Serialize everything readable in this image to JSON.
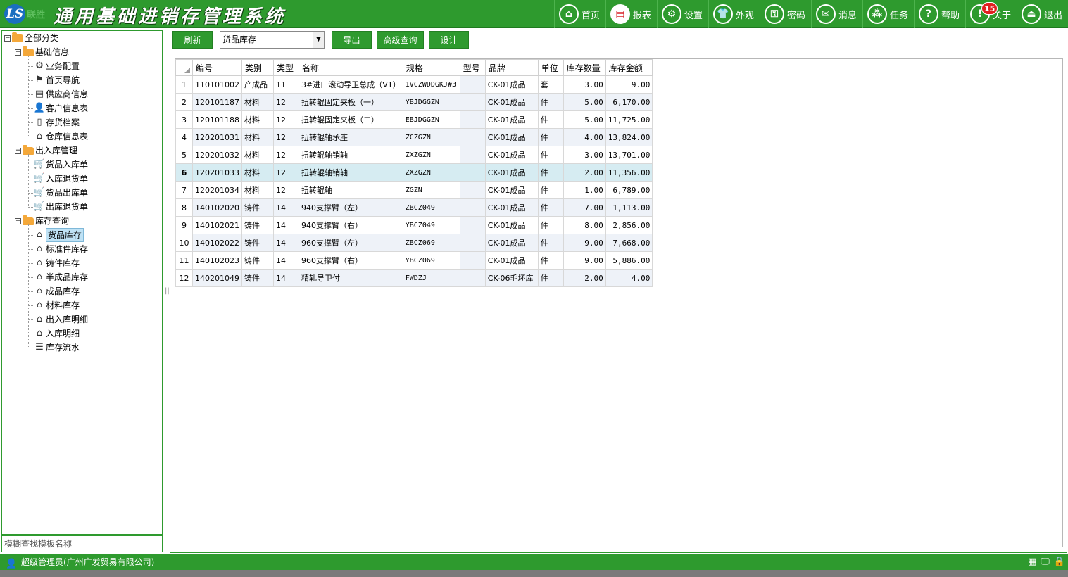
{
  "header": {
    "logo_mark": "LS",
    "logo_sub": "联胜",
    "title": "通用基础进销存管理系统",
    "nav": [
      {
        "label": "首页",
        "icon": "home-icon",
        "glyph": "⌂"
      },
      {
        "label": "报表",
        "icon": "report-icon",
        "glyph": "▤"
      },
      {
        "label": "设置",
        "icon": "gear-icon",
        "glyph": "⚙"
      },
      {
        "label": "外观",
        "icon": "shirt-icon",
        "glyph": "👕"
      },
      {
        "label": "密码",
        "icon": "key-icon",
        "glyph": "⚿"
      },
      {
        "label": "消息",
        "icon": "mail-icon",
        "glyph": "✉"
      },
      {
        "label": "任务",
        "icon": "task-icon",
        "glyph": "⁂"
      },
      {
        "label": "帮助",
        "icon": "help-icon",
        "glyph": "?"
      },
      {
        "label": "关于",
        "icon": "info-icon",
        "glyph": "!",
        "badge": "15"
      },
      {
        "label": "退出",
        "icon": "exit-icon",
        "glyph": "⏏"
      }
    ]
  },
  "tree": {
    "root": "全部分类",
    "groups": [
      {
        "label": "基础信息",
        "items": [
          {
            "label": "业务配置",
            "icon": "gear-icon",
            "glyph": "⚙"
          },
          {
            "label": "首页导航",
            "icon": "signpost-icon",
            "glyph": "⚑"
          },
          {
            "label": "供应商信息",
            "icon": "document-icon",
            "glyph": "▤"
          },
          {
            "label": "客户信息表",
            "icon": "user-icon",
            "glyph": "👤"
          },
          {
            "label": "存货档案",
            "icon": "file-icon",
            "glyph": "▯"
          },
          {
            "label": "仓库信息表",
            "icon": "warehouse-icon",
            "glyph": "⌂"
          }
        ]
      },
      {
        "label": "出入库管理",
        "items": [
          {
            "label": "货品入库单",
            "icon": "cart-icon",
            "glyph": "🛒"
          },
          {
            "label": "入库退货单",
            "icon": "cart-icon",
            "glyph": "🛒"
          },
          {
            "label": "货品出库单",
            "icon": "cart-icon",
            "glyph": "🛒"
          },
          {
            "label": "出库退货单",
            "icon": "cart-icon",
            "glyph": "🛒"
          }
        ]
      },
      {
        "label": "库存查询",
        "items": [
          {
            "label": "货品库存",
            "icon": "warehouse-icon",
            "glyph": "⌂",
            "selected": true
          },
          {
            "label": "标准件库存",
            "icon": "warehouse-icon",
            "glyph": "⌂"
          },
          {
            "label": "铸件库存",
            "icon": "warehouse-icon",
            "glyph": "⌂"
          },
          {
            "label": "半成品库存",
            "icon": "warehouse-icon",
            "glyph": "⌂"
          },
          {
            "label": "成品库存",
            "icon": "warehouse-icon",
            "glyph": "⌂"
          },
          {
            "label": "材料库存",
            "icon": "warehouse-icon",
            "glyph": "⌂"
          },
          {
            "label": "出入库明细",
            "icon": "warehouse-icon",
            "glyph": "⌂"
          },
          {
            "label": "入库明细",
            "icon": "warehouse-icon",
            "glyph": "⌂"
          },
          {
            "label": "库存流水",
            "icon": "list-icon",
            "glyph": "☰"
          }
        ]
      }
    ]
  },
  "search": {
    "placeholder": "模糊查找模板名称"
  },
  "toolbar": {
    "refresh": "刷新",
    "select_value": "货品库存",
    "export": "导出",
    "advanced": "高级查询",
    "design": "设计"
  },
  "grid": {
    "columns": [
      "编号",
      "类别",
      "类型",
      "名称",
      "规格",
      "型号",
      "品牌",
      "单位",
      "库存数量",
      "库存金额"
    ],
    "rows": [
      [
        "1",
        "110101002",
        "产成品",
        "11",
        "3#进口滚动导卫总成（V1）",
        "1VCZWDDGKJ#3",
        "",
        "CK-01成品",
        "套",
        "3.00",
        "9.00"
      ],
      [
        "2",
        "120101187",
        "材料",
        "12",
        "扭转辊固定夹板（一）",
        "YBJDGGZN",
        "",
        "CK-01成品",
        "件",
        "5.00",
        "6,170.00"
      ],
      [
        "3",
        "120101188",
        "材料",
        "12",
        "扭转辊固定夹板（二）",
        "EBJDGGZN",
        "",
        "CK-01成品",
        "件",
        "5.00",
        "11,725.00"
      ],
      [
        "4",
        "120201031",
        "材料",
        "12",
        "扭转辊轴承座",
        "ZCZGZN",
        "",
        "CK-01成品",
        "件",
        "4.00",
        "13,824.00"
      ],
      [
        "5",
        "120201032",
        "材料",
        "12",
        "扭转辊轴销轴",
        "ZXZGZN",
        "",
        "CK-01成品",
        "件",
        "3.00",
        "13,701.00"
      ],
      [
        "6",
        "120201033",
        "材料",
        "12",
        "扭转辊轴销轴",
        "ZXZGZN",
        "",
        "CK-01成品",
        "件",
        "2.00",
        "11,356.00"
      ],
      [
        "7",
        "120201034",
        "材料",
        "12",
        "扭转辊轴",
        "ZGZN",
        "",
        "CK-01成品",
        "件",
        "1.00",
        "6,789.00"
      ],
      [
        "8",
        "140102020",
        "铸件",
        "14",
        "940支撑臂（左）",
        "ZBCZ049",
        "",
        "CK-01成品",
        "件",
        "7.00",
        "1,113.00"
      ],
      [
        "9",
        "140102021",
        "铸件",
        "14",
        "940支撑臂（右）",
        "YBCZ049",
        "",
        "CK-01成品",
        "件",
        "8.00",
        "2,856.00"
      ],
      [
        "10",
        "140102022",
        "铸件",
        "14",
        "960支撑臂（左）",
        "ZBCZ069",
        "",
        "CK-01成品",
        "件",
        "9.00",
        "7,668.00"
      ],
      [
        "11",
        "140102023",
        "铸件",
        "14",
        "960支撑臂（右）",
        "YBCZ069",
        "",
        "CK-01成品",
        "件",
        "9.00",
        "5,886.00"
      ],
      [
        "12",
        "140201049",
        "铸件",
        "14",
        "精轧导卫付",
        "FWDZJ",
        "",
        "CK-06毛坯库",
        "件",
        "2.00",
        "4.00"
      ]
    ],
    "highlighted_row": 6
  },
  "status": {
    "user": "超级管理员(广州广发贸易有限公司)",
    "icons": [
      {
        "name": "grid-icon",
        "glyph": "▦"
      },
      {
        "name": "monitor-icon",
        "glyph": "🖵"
      },
      {
        "name": "lock-icon",
        "glyph": "🔒"
      }
    ]
  }
}
